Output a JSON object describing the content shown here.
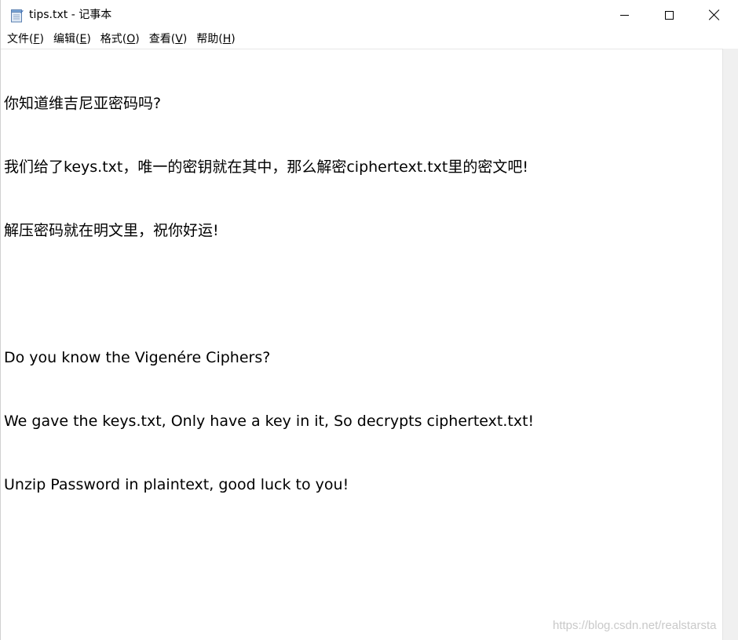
{
  "window": {
    "title": "tips.txt - 记事本",
    "app_icon": "notepad-icon"
  },
  "caption_buttons": {
    "minimize_icon": "minimize-icon",
    "maximize_icon": "maximize-icon",
    "close_icon": "close-icon"
  },
  "menu": [
    {
      "label": "文件(",
      "key": "F",
      "tail": ")"
    },
    {
      "label": "编辑(",
      "key": "E",
      "tail": ")"
    },
    {
      "label": "格式(",
      "key": "O",
      "tail": ")"
    },
    {
      "label": "查看(",
      "key": "V",
      "tail": ")"
    },
    {
      "label": "帮助(",
      "key": "H",
      "tail": ")"
    }
  ],
  "document": {
    "lines": [
      "你知道维吉尼亚密码吗?",
      "我们给了keys.txt，唯一的密钥就在其中，那么解密ciphertext.txt里的密文吧!",
      "解压密码就在明文里，祝你好运!",
      "",
      "Do you know the Vigenére Ciphers?",
      "We gave the keys.txt, Only have a key in it, So decrypts ciphertext.txt!",
      "Unzip Password in plaintext, good luck to you!"
    ]
  },
  "watermark": "https://blog.csdn.net/realstarsta"
}
